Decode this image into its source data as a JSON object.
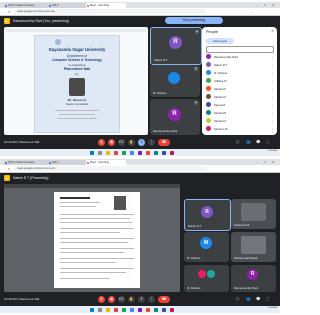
{
  "shot1": {
    "tabs": [
      "GPT-4 Class Company",
      "Tab 2",
      "Meet - recording"
    ],
    "url": "meet.google.com/xxx-xxxx-xxx",
    "meeting_title": "Ramamoorthy Rani (You, presenting)",
    "presenting_label": "Stop presenting",
    "slide": {
      "university": "Dayananda Sagar University",
      "dept": "Department of",
      "dept2": "Computer Science & Technology",
      "event": "is organizing",
      "event2": "Placement talk",
      "by": "by",
      "speaker": "Mr. Naveen K",
      "role": "Senior Consultant"
    },
    "tiles": [
      {
        "initial": "R",
        "name": "Nalem R.T"
      },
      {
        "initial": "",
        "name": "M. Kishore"
      },
      {
        "initial": "R",
        "name": "Ramamoorthy Rani"
      }
    ],
    "people_panel": {
      "title": "People",
      "add_label": "Add people",
      "participants": [
        "Ramamoorthy Rani",
        "Nalem R.T",
        "M. Kishore",
        "Adhitya M",
        "Student 5",
        "Student 6",
        "Kavya M",
        "Student 8",
        "Student 9",
        "Student 10"
      ]
    },
    "time": "10:44 AM",
    "meeting_name": "Placement Talk"
  },
  "shot2": {
    "meeting_title": "Nalem R.T (Presenting)",
    "tiles": [
      {
        "initial": "R",
        "name": "Nalem R.T"
      },
      {
        "initial": "",
        "name": "Kishore M.S"
      },
      {
        "initial": "M",
        "name": "M. Kishore"
      },
      {
        "initial": "",
        "name": "Student participant"
      },
      {
        "initial": "",
        "name": "M. Kishore"
      },
      {
        "initial": "R",
        "name": "Ramamoorthy Rani"
      }
    ],
    "time": "10:48 AM",
    "meeting_name": "Placement Talk"
  },
  "icons": {
    "mic": "mic-icon",
    "camera": "camera-icon",
    "captions": "captions-icon",
    "hand": "raise-hand-icon",
    "present": "present-icon",
    "more": "more-icon",
    "end": "end-call-icon"
  }
}
